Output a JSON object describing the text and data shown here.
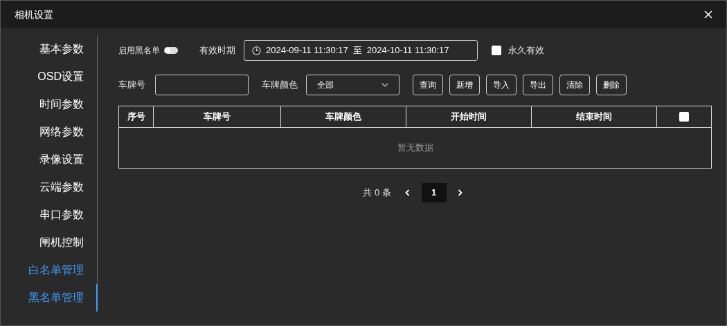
{
  "window": {
    "title": "相机设置"
  },
  "sidebar": {
    "items": [
      {
        "label": "基本参数",
        "selected": false,
        "highlighted": false
      },
      {
        "label": "OSD设置",
        "selected": false,
        "highlighted": false
      },
      {
        "label": "时间参数",
        "selected": false,
        "highlighted": false
      },
      {
        "label": "网络参数",
        "selected": false,
        "highlighted": false
      },
      {
        "label": "录像设置",
        "selected": false,
        "highlighted": false
      },
      {
        "label": "云端参数",
        "selected": false,
        "highlighted": false
      },
      {
        "label": "串口参数",
        "selected": false,
        "highlighted": false
      },
      {
        "label": "闸机控制",
        "selected": false,
        "highlighted": false
      },
      {
        "label": "白名单管理",
        "selected": false,
        "highlighted": true
      },
      {
        "label": "黑名单管理",
        "selected": true,
        "highlighted": true
      }
    ]
  },
  "blacklist_toggle": {
    "label": "启用黑名单",
    "on": false
  },
  "validity": {
    "label": "有效时期",
    "start": "2024-09-11 11:30:17",
    "separator": "至",
    "end": "2024-10-11 11:30:17"
  },
  "permanent": {
    "label": "永久有效",
    "checked": false
  },
  "plate_field": {
    "label": "车牌号"
  },
  "plate_color": {
    "label": "车牌颜色",
    "value": "全部"
  },
  "buttons": [
    "查询",
    "新增",
    "导入",
    "导出",
    "清除",
    "删除"
  ],
  "table": {
    "columns": [
      "序号",
      "车牌号",
      "车牌颜色",
      "开始时间",
      "结束时间"
    ],
    "select_all_checked": false,
    "empty_text": "暂无数据"
  },
  "pagination": {
    "total": "共 0 条",
    "pages": [
      {
        "label": "1",
        "selected": true
      }
    ]
  }
}
